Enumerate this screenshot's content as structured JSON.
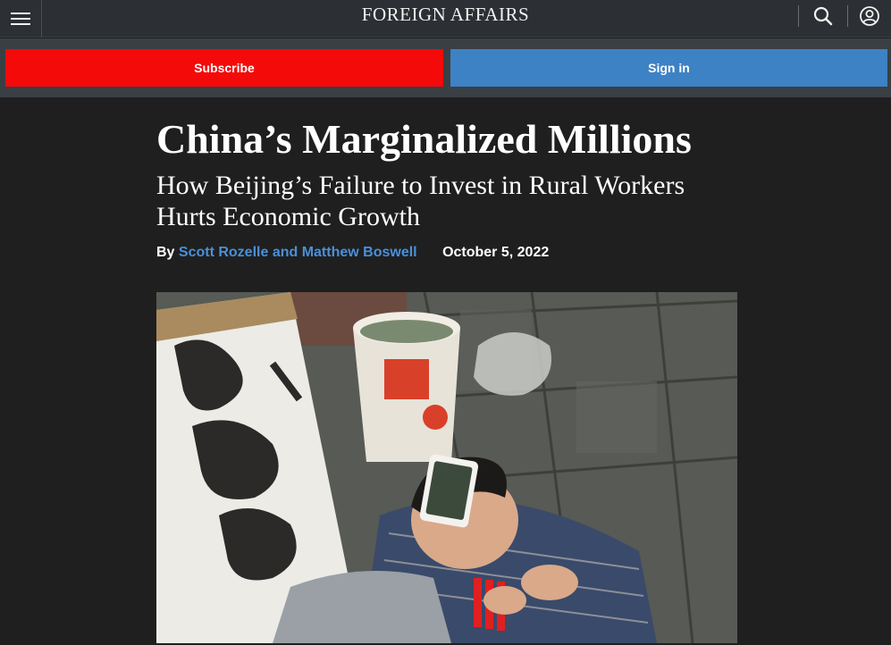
{
  "header": {
    "logo_text": "FOREIGN AFFAIRS",
    "menu_icon": "hamburger-menu-icon",
    "search_icon": "search-icon",
    "account_icon": "user-account-icon"
  },
  "actions": {
    "subscribe_label": "Subscribe",
    "signin_label": "Sign in",
    "subscribe_color": "#f50a0a",
    "signin_color": "#3d82c4"
  },
  "article": {
    "title": "China’s Marginalized Millions",
    "subtitle": "How Beijing’s Failure to Invest in Rural Workers Hurts Economic Growth",
    "byline_prefix": "By",
    "authors": "Scott Rozelle and Matthew Boswell",
    "date": "October 5, 2022",
    "author_link_color": "#4a90d9"
  },
  "image": {
    "content": "child-sleeping-with-phone-photo"
  }
}
